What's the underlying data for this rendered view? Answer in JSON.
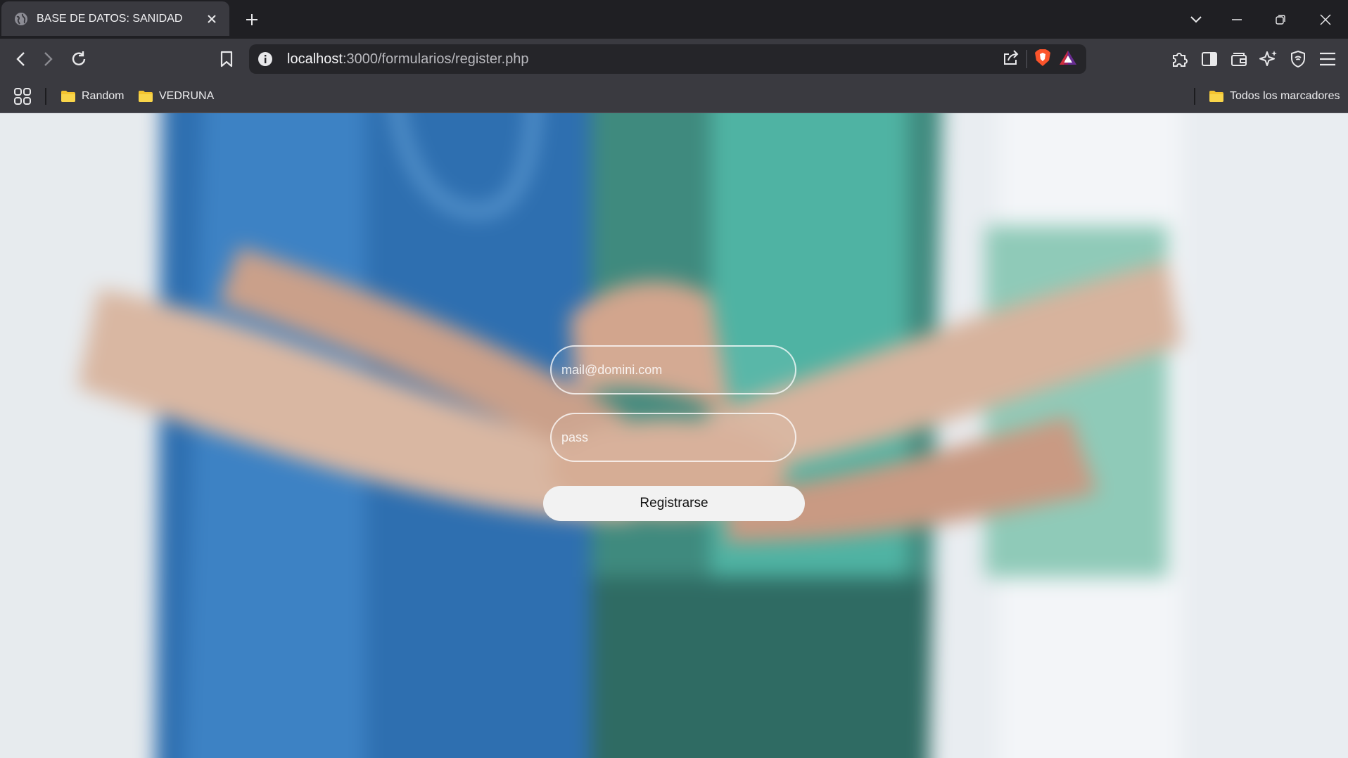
{
  "browser": {
    "tab": {
      "title": "BASE DE DATOS: SANIDAD"
    },
    "address_bar": {
      "host": "localhost",
      "path": ":3000/formularios/register.php"
    },
    "bookmarks": {
      "items": [
        {
          "label": "Random",
          "icon": "folder-icon"
        },
        {
          "label": "VEDRUNA",
          "icon": "folder-icon"
        }
      ],
      "all_bookmarks": "Todos los marcadores"
    }
  },
  "form": {
    "email": {
      "placeholder": "mail@domini.com",
      "value": ""
    },
    "password": {
      "placeholder": "pass",
      "value": ""
    },
    "submit_label": "Registrarse"
  },
  "colors": {
    "tab_strip": "#1f1f23",
    "toolbar": "#3a3a40",
    "brave_orange": "#fb542b",
    "folder_yellow": "#f4c430"
  }
}
